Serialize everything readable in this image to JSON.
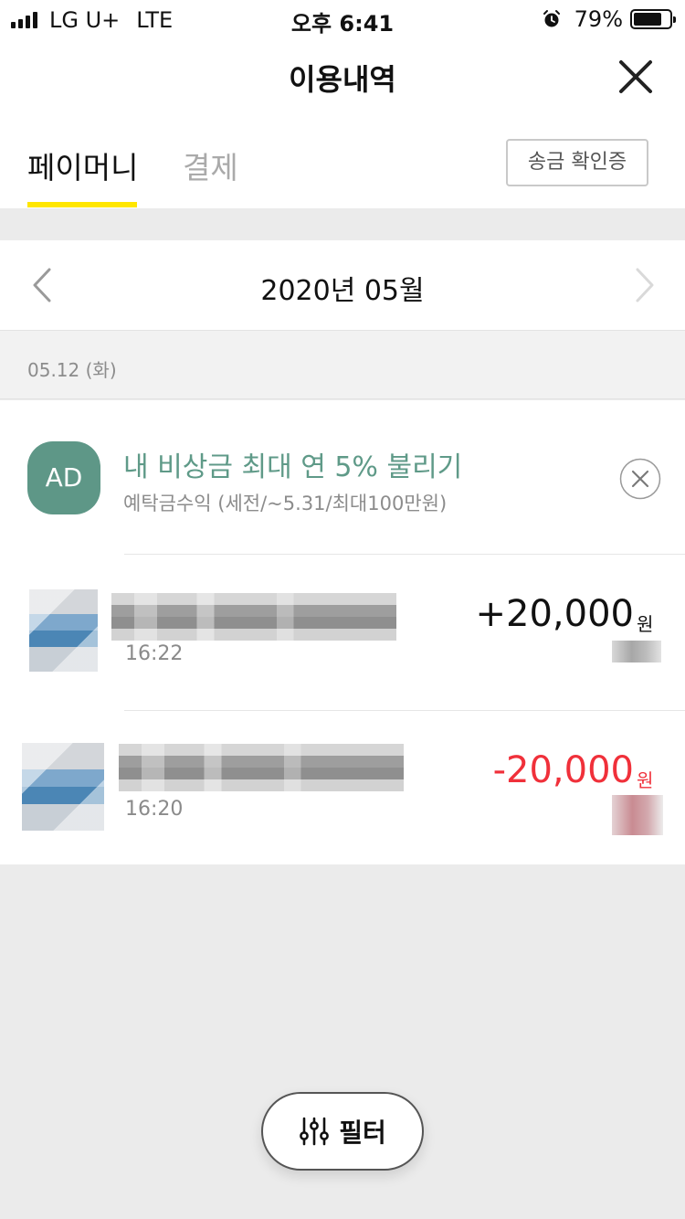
{
  "status_bar": {
    "carrier": "LG U+",
    "network": "LTE",
    "time": "오후 6:41",
    "battery": "79%",
    "battery_level": 0.79
  },
  "header": {
    "title": "이용내역"
  },
  "tabs": [
    {
      "label": "페이머니",
      "active": true
    },
    {
      "label": "결제",
      "active": false
    }
  ],
  "receipt_button": {
    "label": "송금 확인증"
  },
  "month": {
    "label": "2020년 05월"
  },
  "date_group": {
    "label": "05.12 (화)"
  },
  "ad": {
    "badge": "AD",
    "title": "내 비상금 최대 연 5% 불리기",
    "subtitle": "예탁금수익 (세전/~5.31/최대100만원)"
  },
  "transactions": [
    {
      "time": "16:22",
      "amount": "+20,000",
      "unit": "원",
      "amount_color": "#111111"
    },
    {
      "time": "16:20",
      "amount": "-20,000",
      "unit": "원",
      "amount_color": "#f0303a"
    }
  ],
  "filter_button": {
    "label": "필터"
  },
  "colors": {
    "tab_accent": "#ffe600",
    "ad_green": "#5e9787",
    "negative": "#f0303a"
  }
}
